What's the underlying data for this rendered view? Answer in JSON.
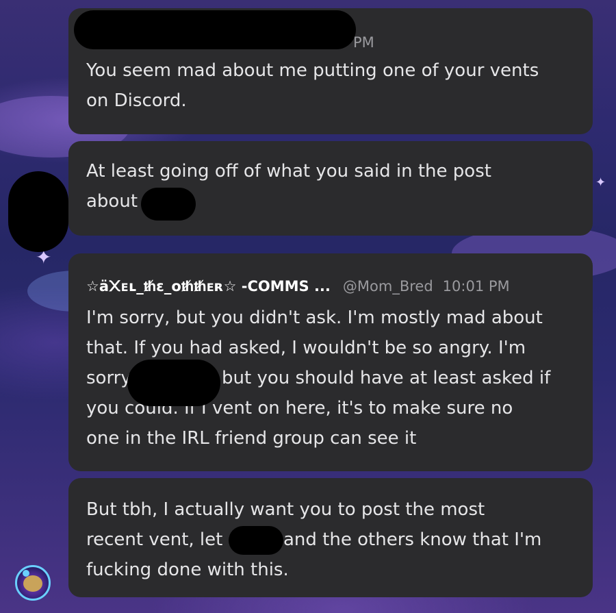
{
  "messages": [
    {
      "time_fragment": "PM",
      "text_lines": [
        "You seem mad about me putting one of your vents",
        "on Discord."
      ]
    },
    {
      "text_lines": [
        "At least going off of what you said in the post",
        "about"
      ]
    },
    {
      "author": "☆ä᙭ᴇʟ_ᵺɛ_oᵺᵺᴇʀ☆ -COMMS ...",
      "handle": "@Mom_Bred",
      "time": "10:01 PM",
      "text_lines": [
        "I'm sorry, but you didn't ask. I'm mostly mad about",
        "that. If you had asked, I wouldn't be so angry. I'm",
        "sorry",
        "but you should have at least asked if",
        "you could. If I vent on here, it's to make sure no",
        "one in the IRL friend group can see it"
      ]
    },
    {
      "text_lines": [
        "But tbh, I actually want you to post the most",
        "recent vent, let",
        "and the others know that I'm",
        "fucking done with this."
      ]
    }
  ],
  "colors": {
    "bubble": "#2b2b2d",
    "text": "#e6e6e8",
    "meta": "#9a9a9e",
    "redaction": "#000000"
  },
  "icons": {
    "sparkle": "sparkle-icon",
    "avatar": "avatar"
  }
}
